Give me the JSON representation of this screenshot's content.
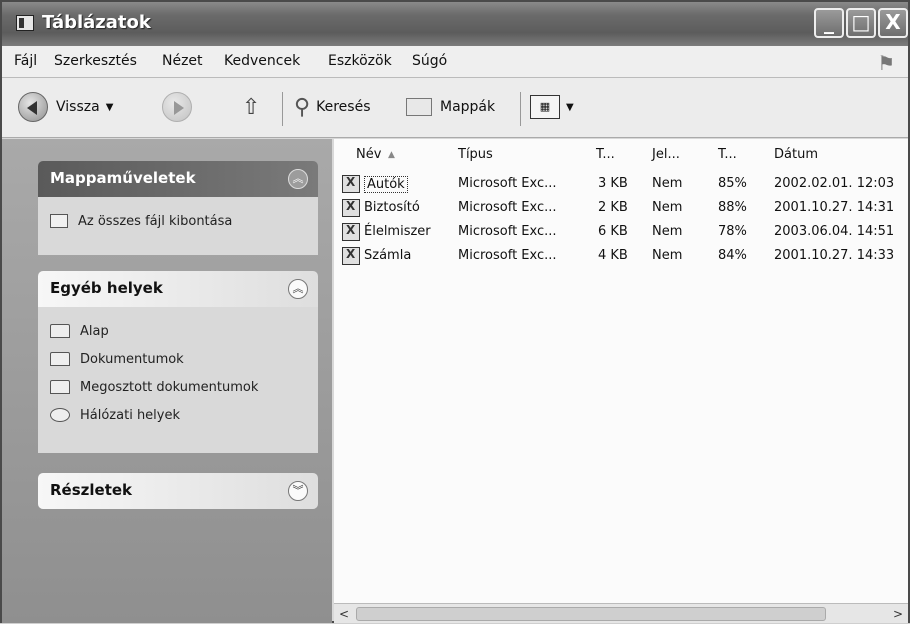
{
  "window": {
    "title": "Táblázatok",
    "controls": {
      "minimize": "_",
      "maximize": "□",
      "close": "X"
    }
  },
  "menu": [
    "Fájl",
    "Szerkesztés",
    "Nézet",
    "Kedvencek",
    "Eszközök",
    "Súgó"
  ],
  "toolbar": {
    "back": "Vissza",
    "search": "Keresés",
    "folders": "Mappák"
  },
  "tasks_panel": {
    "title": "Mappaműveletek",
    "items": [
      "Az összes fájl kibontása"
    ]
  },
  "other_places": {
    "title": "Egyéb helyek",
    "items": [
      "Alap",
      "Dokumentumok",
      "Megosztott dokumentumok",
      "Hálózati helyek"
    ]
  },
  "details_panel": {
    "title": "Részletek"
  },
  "columns": [
    "Név",
    "Típus",
    "T...",
    "Jel...",
    "T...",
    "Dátum"
  ],
  "files": [
    {
      "name": "Autók",
      "type": "Microsoft Exc...",
      "size": "3 KB",
      "protected": "Nem",
      "ratio": "85%",
      "date": "2002.02.01. 12:03"
    },
    {
      "name": "Biztosító",
      "type": "Microsoft Exc...",
      "size": "2 KB",
      "protected": "Nem",
      "ratio": "88%",
      "date": "2001.10.27. 14:31"
    },
    {
      "name": "Élelmiszer",
      "type": "Microsoft Exc...",
      "size": "6 KB",
      "protected": "Nem",
      "ratio": "78%",
      "date": "2003.06.04. 14:51"
    },
    {
      "name": "Számla",
      "type": "Microsoft Exc...",
      "size": "4 KB",
      "protected": "Nem",
      "ratio": "84%",
      "date": "2001.10.27. 14:33"
    }
  ]
}
